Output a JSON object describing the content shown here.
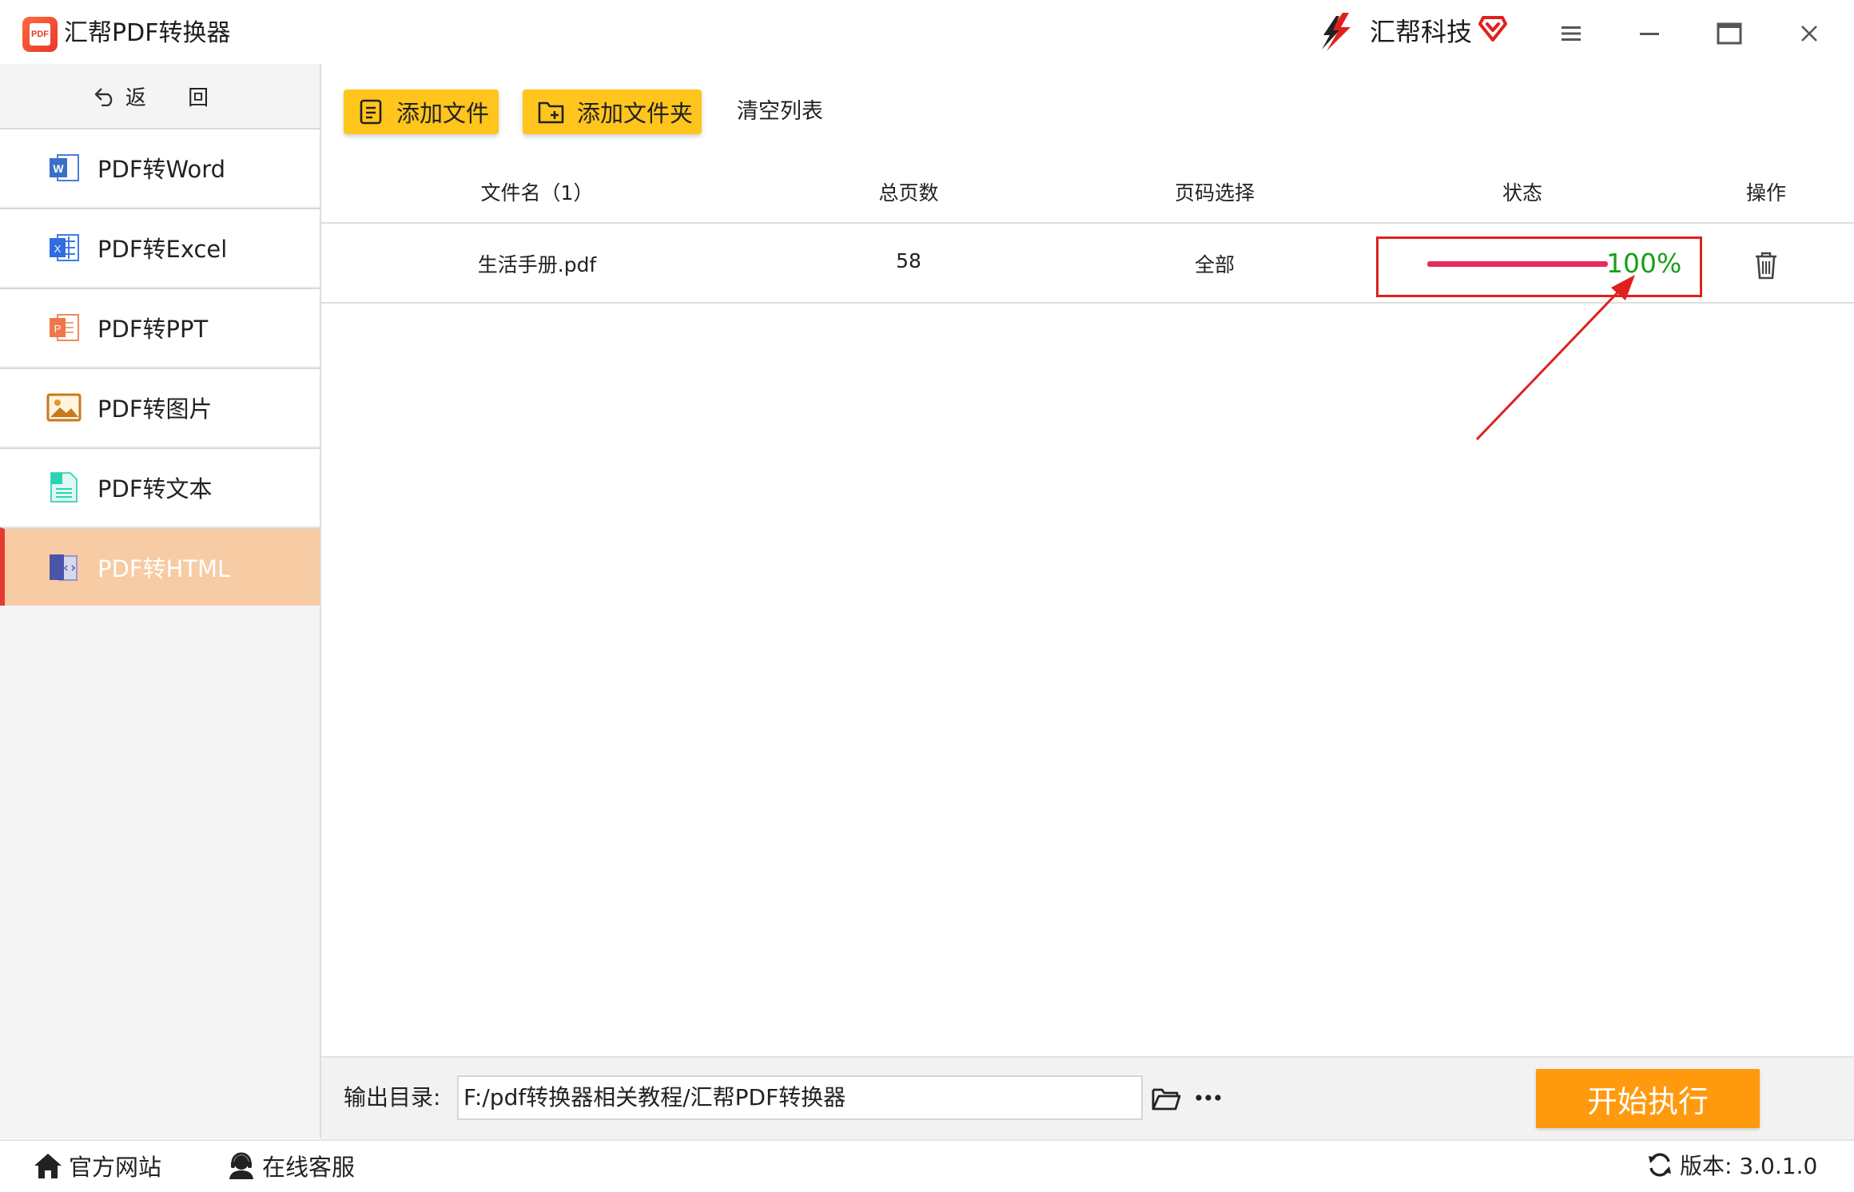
{
  "window": {
    "title": "汇帮PDF转换器",
    "logo_text": "PDF",
    "brand_name": "汇帮科技"
  },
  "sidebar": {
    "back_label": "返 回",
    "items": [
      {
        "label": "PDF转Word",
        "icon": "word-icon",
        "active": false
      },
      {
        "label": "PDF转Excel",
        "icon": "excel-icon",
        "active": false
      },
      {
        "label": "PDF转PPT",
        "icon": "ppt-icon",
        "active": false
      },
      {
        "label": "PDF转图片",
        "icon": "image-icon",
        "active": false
      },
      {
        "label": "PDF转文本",
        "icon": "text-icon",
        "active": false
      },
      {
        "label": "PDF转HTML",
        "icon": "html-icon",
        "active": true
      }
    ]
  },
  "toolbar": {
    "add_file": "添加文件",
    "add_folder": "添加文件夹",
    "clear_list": "清空列表"
  },
  "table": {
    "headers": {
      "filename": "文件名（1）",
      "total_pages": "总页数",
      "page_select": "页码选择",
      "status": "状态",
      "action": "操作"
    },
    "rows": [
      {
        "filename": "生活手册.pdf",
        "total_pages": "58",
        "page_select": "全部",
        "progress": 1.0,
        "progress_text": "100%"
      }
    ]
  },
  "output": {
    "label": "输出目录:",
    "path": "F:/pdf转换器相关教程/汇帮PDF转换器",
    "start_button": "开始执行"
  },
  "footer": {
    "website": "官方网站",
    "online_service": "在线客服",
    "version": "版本:  3.0.1.0"
  },
  "colors": {
    "accent_yellow": "#ffc51c",
    "start_orange": "#ff9a0e",
    "active_item_bg": "#f7cba3",
    "progress_pink": "#e62a5f",
    "progress_text_green": "#1a9e1a",
    "annotation_red": "#e0201d"
  }
}
